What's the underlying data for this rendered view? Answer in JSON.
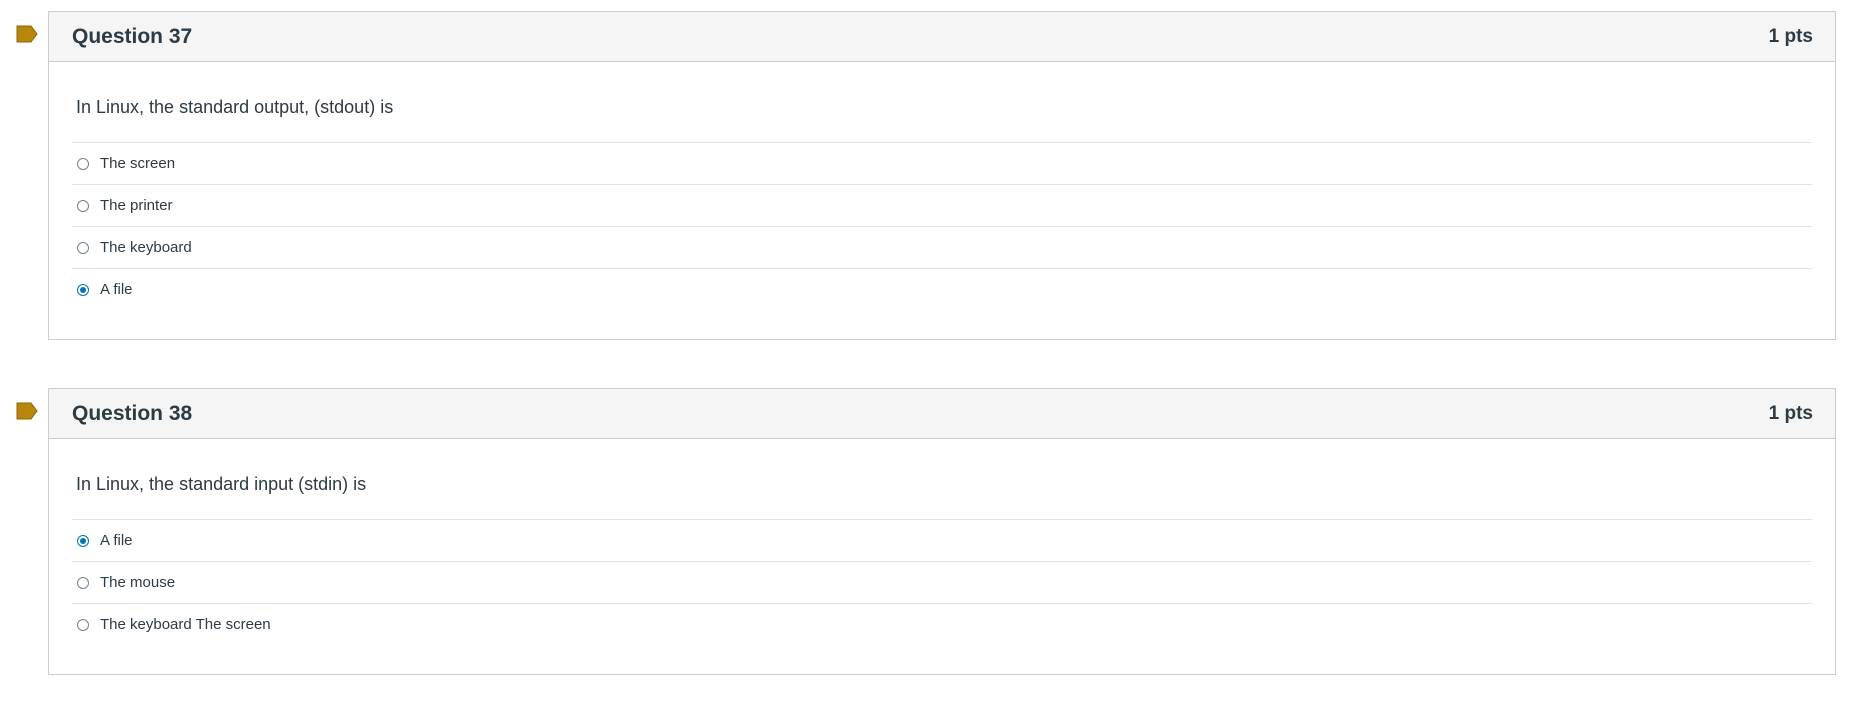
{
  "colors": {
    "flag": "#b8860b",
    "border": "#c7cdd1",
    "header_bg": "#f5f5f5",
    "radio_selected": "#0374b5",
    "text": "#2d3b45"
  },
  "questions": [
    {
      "title": "Question 37",
      "points": "1 pts",
      "text": "In Linux, the standard output, (stdout) is",
      "answers": [
        {
          "label": "The screen",
          "selected": false
        },
        {
          "label": "The printer",
          "selected": false
        },
        {
          "label": "The keyboard",
          "selected": false
        },
        {
          "label": "A file",
          "selected": true
        }
      ]
    },
    {
      "title": "Question 38",
      "points": "1 pts",
      "text": "In Linux, the standard input (stdin) is",
      "answers": [
        {
          "label": "A file",
          "selected": true
        },
        {
          "label": "The mouse",
          "selected": false
        },
        {
          "label": "The keyboard The screen",
          "selected": false
        }
      ]
    }
  ]
}
